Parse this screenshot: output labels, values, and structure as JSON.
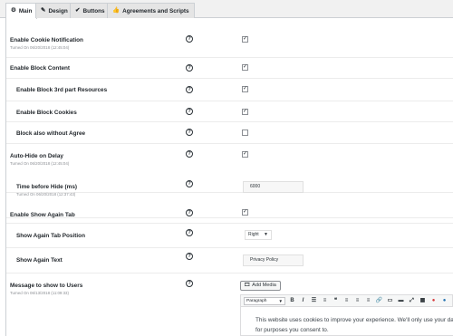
{
  "tabs": [
    {
      "label": "Main",
      "icon": "gear-icon"
    },
    {
      "label": "Design",
      "icon": "pencil-icon"
    },
    {
      "label": "Buttons",
      "icon": "check-circle-icon"
    },
    {
      "label": "Agreements and Scripts",
      "icon": "thumbs-up-icon"
    }
  ],
  "rows": {
    "cookie_notification": {
      "label": "Enable Cookie Notification",
      "sub": "Turned On 06/20/2018 (12:45:04)",
      "checked": true
    },
    "block_content": {
      "label": "Enable Block Content",
      "checked": true
    },
    "block_3rd_party": {
      "label": "Enable Block 3rd part Resources",
      "checked": true
    },
    "block_cookies": {
      "label": "Enable Block Cookies",
      "checked": true
    },
    "block_without_agree": {
      "label": "Block also without Agree",
      "checked": false
    },
    "auto_hide": {
      "label": "Auto-Hide on Delay",
      "sub": "Turned On 06/20/2018 (12:45:04)",
      "checked": true
    },
    "time_before_hide": {
      "label": "Time before Hide (ms)",
      "sub": "Turned On 06/20/2018 (12:37:43)",
      "value": "6000"
    },
    "show_again_tab": {
      "label": "Enable Show Again Tab",
      "checked": true
    },
    "tab_position": {
      "label": "Show Again Tab Position",
      "value": "Right"
    },
    "again_text": {
      "label": "Show Again Text",
      "value": "Privacy Policy"
    },
    "message": {
      "label": "Message to show to Users",
      "sub": "Turned On 06/13/2018 (11:09:33)"
    }
  },
  "help_symbol": "?",
  "check_symbol": "✓",
  "editor": {
    "add_media_label": "Add Media",
    "format_select": "Paragraph",
    "content": "This website uses cookies to improve your experience. We'll only use your data for purposes you consent to."
  },
  "colors": {
    "page_bg": "#ffffff",
    "tab_bg": "#e5e5e5",
    "border": "#ccd0d4",
    "subtext": "#8c8f94"
  }
}
